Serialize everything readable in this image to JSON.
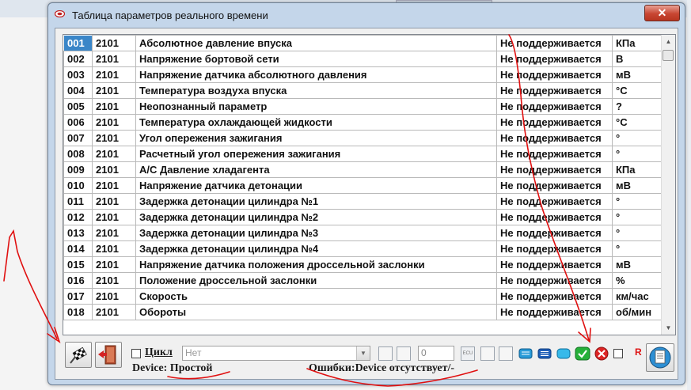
{
  "window": {
    "title": "Таблица параметров реального времени",
    "close_label": "✕"
  },
  "table": {
    "rows": [
      {
        "num": "001",
        "code": "2101",
        "name": "Абсолютное давление впуска",
        "value": "Не поддерживается",
        "unit": "КПа"
      },
      {
        "num": "002",
        "code": "2101",
        "name": "Напряжение бортовой сети",
        "value": "Не поддерживается",
        "unit": "В"
      },
      {
        "num": "003",
        "code": "2101",
        "name": "Напряжение датчика абсолютного давления",
        "value": "Не поддерживается",
        "unit": "мВ"
      },
      {
        "num": "004",
        "code": "2101",
        "name": "Температура воздуха впуска",
        "value": "Не поддерживается",
        "unit": "°C"
      },
      {
        "num": "005",
        "code": "2101",
        "name": "Неопознанный параметр",
        "value": "Не поддерживается",
        "unit": "?"
      },
      {
        "num": "006",
        "code": "2101",
        "name": "Температура охлаждающей жидкости",
        "value": "Не поддерживается",
        "unit": "°C"
      },
      {
        "num": "007",
        "code": "2101",
        "name": "Угол опережения зажигания",
        "value": "Не поддерживается",
        "unit": "°"
      },
      {
        "num": "008",
        "code": "2101",
        "name": "Расчетный угол опережения зажигания",
        "value": "Не поддерживается",
        "unit": "°"
      },
      {
        "num": "009",
        "code": "2101",
        "name": "A/C Давление хладагента",
        "value": "Не поддерживается",
        "unit": "КПа"
      },
      {
        "num": "010",
        "code": "2101",
        "name": "Напряжение датчика детонации",
        "value": "Не поддерживается",
        "unit": "мВ"
      },
      {
        "num": "011",
        "code": "2101",
        "name": "Задержка детонации цилиндра №1",
        "value": "Не поддерживается",
        "unit": "°"
      },
      {
        "num": "012",
        "code": "2101",
        "name": "Задержка детонации цилиндра №2",
        "value": "Не поддерживается",
        "unit": "°"
      },
      {
        "num": "013",
        "code": "2101",
        "name": "Задержка детонации цилиндра №3",
        "value": "Не поддерживается",
        "unit": "°"
      },
      {
        "num": "014",
        "code": "2101",
        "name": "Задержка детонации цилиндра №4",
        "value": "Не поддерживается",
        "unit": "°"
      },
      {
        "num": "015",
        "code": "2101",
        "name": "Напряжение датчика положения дроссельной заслонки",
        "value": "Не поддерживается",
        "unit": "мВ"
      },
      {
        "num": "016",
        "code": "2101",
        "name": "Положение дроссельной заслонки",
        "value": "Не поддерживается",
        "unit": "%"
      },
      {
        "num": "017",
        "code": "2101",
        "name": "Скорость",
        "value": "Не поддерживается",
        "unit": "км/час"
      },
      {
        "num": "018",
        "code": "2101",
        "name": "Обороты",
        "value": "Не поддерживается",
        "unit": "об/мин"
      }
    ]
  },
  "toolbar": {
    "cycle_label": "Цикл",
    "cycle_checked": false,
    "combo_value": "Нет",
    "number_value": "0",
    "ecu_label": "ECU",
    "r_label": "R",
    "r_checked": false
  },
  "status": {
    "device": "Device: Простой",
    "errors": "Ошибки:Device отсутствует/-"
  },
  "icons": {
    "run": "checkered-flag-icon",
    "exit": "exit-door-icon",
    "ok": "green-check-icon",
    "cancel": "red-x-icon",
    "help": "document-icon"
  },
  "colors": {
    "selected_cell": "#3a86c8",
    "title_bar": "#c4d6ea",
    "annotation_ink": "#e01010"
  }
}
